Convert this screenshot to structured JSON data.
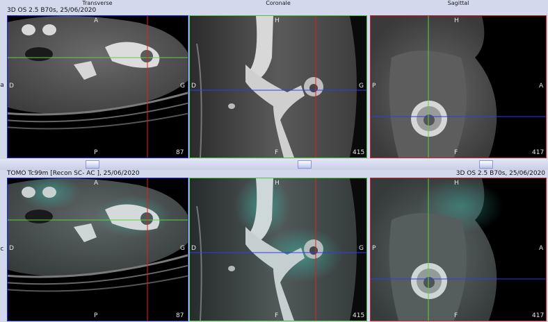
{
  "headers": {
    "transverse": "Transverse",
    "coronal": "Coronale",
    "sagittal": "Sagittal"
  },
  "rows": {
    "top_label": "3D OS  2.5  B70s, 25/06/2020",
    "bottom_label_left": "TOMO Tc99m [Recon SC- AC ], 25/06/2020",
    "bottom_label_right": "3D OS  2.5  B70s, 25/06/2020"
  },
  "side_letters": {
    "top": "a",
    "bottom": "c"
  },
  "panels": {
    "transverse": {
      "top": "A",
      "bottom": "P",
      "left": "D",
      "right": "G",
      "slice": "87"
    },
    "coronal": {
      "top": "H",
      "bottom": "F",
      "left": "D",
      "right": "G",
      "slice": "415"
    },
    "sagittal": {
      "top": "H",
      "bottom": "F",
      "left": "P",
      "right": "A",
      "slice": "417"
    }
  },
  "colors": {
    "transverse_border": "#1c2bd6",
    "coronal_border": "#52c23a",
    "sagittal_border": "#c8262a",
    "crosshair_red": "#e02020",
    "crosshair_green": "#5ad23c",
    "crosshair_blue": "#2a3cff",
    "fusion_tint": "#3fb8a8"
  },
  "icons": {
    "scroll_thumb": "slider-thumb-icon"
  }
}
